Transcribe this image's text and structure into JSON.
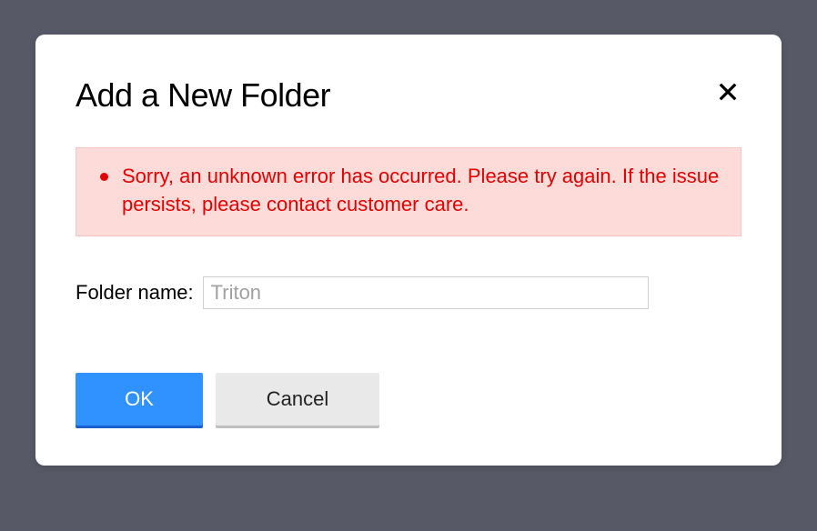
{
  "dialog": {
    "title": "Add a New Folder",
    "error": {
      "message": "Sorry, an unknown error has occurred. Please try again. If the issue persists, please contact customer care."
    },
    "form": {
      "label": "Folder name:",
      "placeholder": "Triton",
      "value": ""
    },
    "buttons": {
      "ok": "OK",
      "cancel": "Cancel"
    }
  }
}
